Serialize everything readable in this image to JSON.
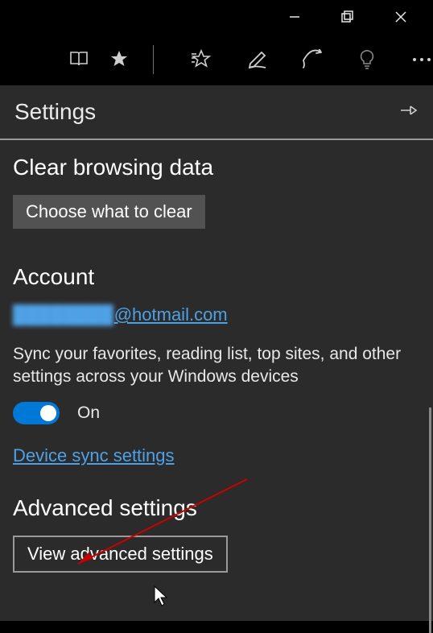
{
  "titlebar": {
    "minimize": "minimize",
    "maximize": "maximize",
    "close": "close"
  },
  "toolbar": {
    "reading_list": "reading-list",
    "favorites": "favorites",
    "add_favorite": "add-favorite",
    "annotate": "annotate",
    "share": "share",
    "tips": "tips",
    "more": "more"
  },
  "panel": {
    "title": "Settings",
    "pin": "pin"
  },
  "clear_section": {
    "title": "Clear browsing data",
    "button": "Choose what to clear"
  },
  "account_section": {
    "title": "Account",
    "email_hidden": "████████",
    "email_suffix": "@hotmail.com",
    "sync_desc": "Sync your favorites, reading list, top sites, and other settings across your Windows devices",
    "toggle_state": "On",
    "device_sync_link": "Device sync settings"
  },
  "advanced_section": {
    "title": "Advanced settings",
    "button": "View advanced settings"
  },
  "colors": {
    "accent": "#0078d7",
    "link": "#4fa1e6",
    "panel_bg": "#2b2b2b",
    "btn_bg": "#525252",
    "annotation": "#cc0000"
  }
}
